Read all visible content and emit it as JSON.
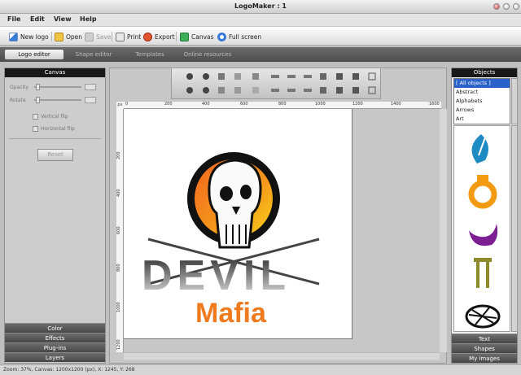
{
  "window": {
    "title": "LogoMaker : 1"
  },
  "menu": [
    "File",
    "Edit",
    "View",
    "Help"
  ],
  "toolbar": {
    "new_logo": "New logo",
    "open": "Open",
    "save": "Save",
    "print": "Print",
    "export": "Export",
    "canvas": "Canvas",
    "full_screen": "Full screen"
  },
  "tabs": [
    "Logo editor",
    "Shape editor",
    "Templates",
    "Online resources"
  ],
  "left_panel": {
    "header": "Canvas",
    "opacity_label": "Opacity",
    "rotate_label": "Rotate",
    "vertical_flip": "Vertical flip",
    "horizontal_flip": "Horizontal flip",
    "reset": "Reset",
    "bottom_tabs": [
      "Color",
      "Effects",
      "Plug-ins",
      "Layers"
    ]
  },
  "rulers": {
    "unit": "px",
    "h_labels": [
      "0",
      "200",
      "400",
      "600",
      "800",
      "1000",
      "1200",
      "1400",
      "1600"
    ],
    "v_labels": [
      "200",
      "400",
      "600",
      "800",
      "1000",
      "1200"
    ]
  },
  "logo": {
    "text_top": "DEVIL",
    "text_bottom": "Mafia",
    "accent_color": "#f07a1e",
    "gradient_color": "#f5c21a"
  },
  "right_panel": {
    "header": "Objects",
    "categories": [
      "[ All objects ]",
      "Abstract",
      "Alphabets",
      "Arrows",
      "Art"
    ],
    "shape_icons": [
      "blue-leaf-shape-icon",
      "orange-ring-shape-icon",
      "purple-moon-shape-icon",
      "olive-table-shape-icon",
      "black-globe-shape-icon"
    ],
    "bottom_tabs": [
      "Text",
      "Shapes",
      "My images"
    ]
  },
  "status": {
    "text": "Zoom: 37%, Canvas: 1200x1200 (px), X: 1245, Y: 268"
  }
}
